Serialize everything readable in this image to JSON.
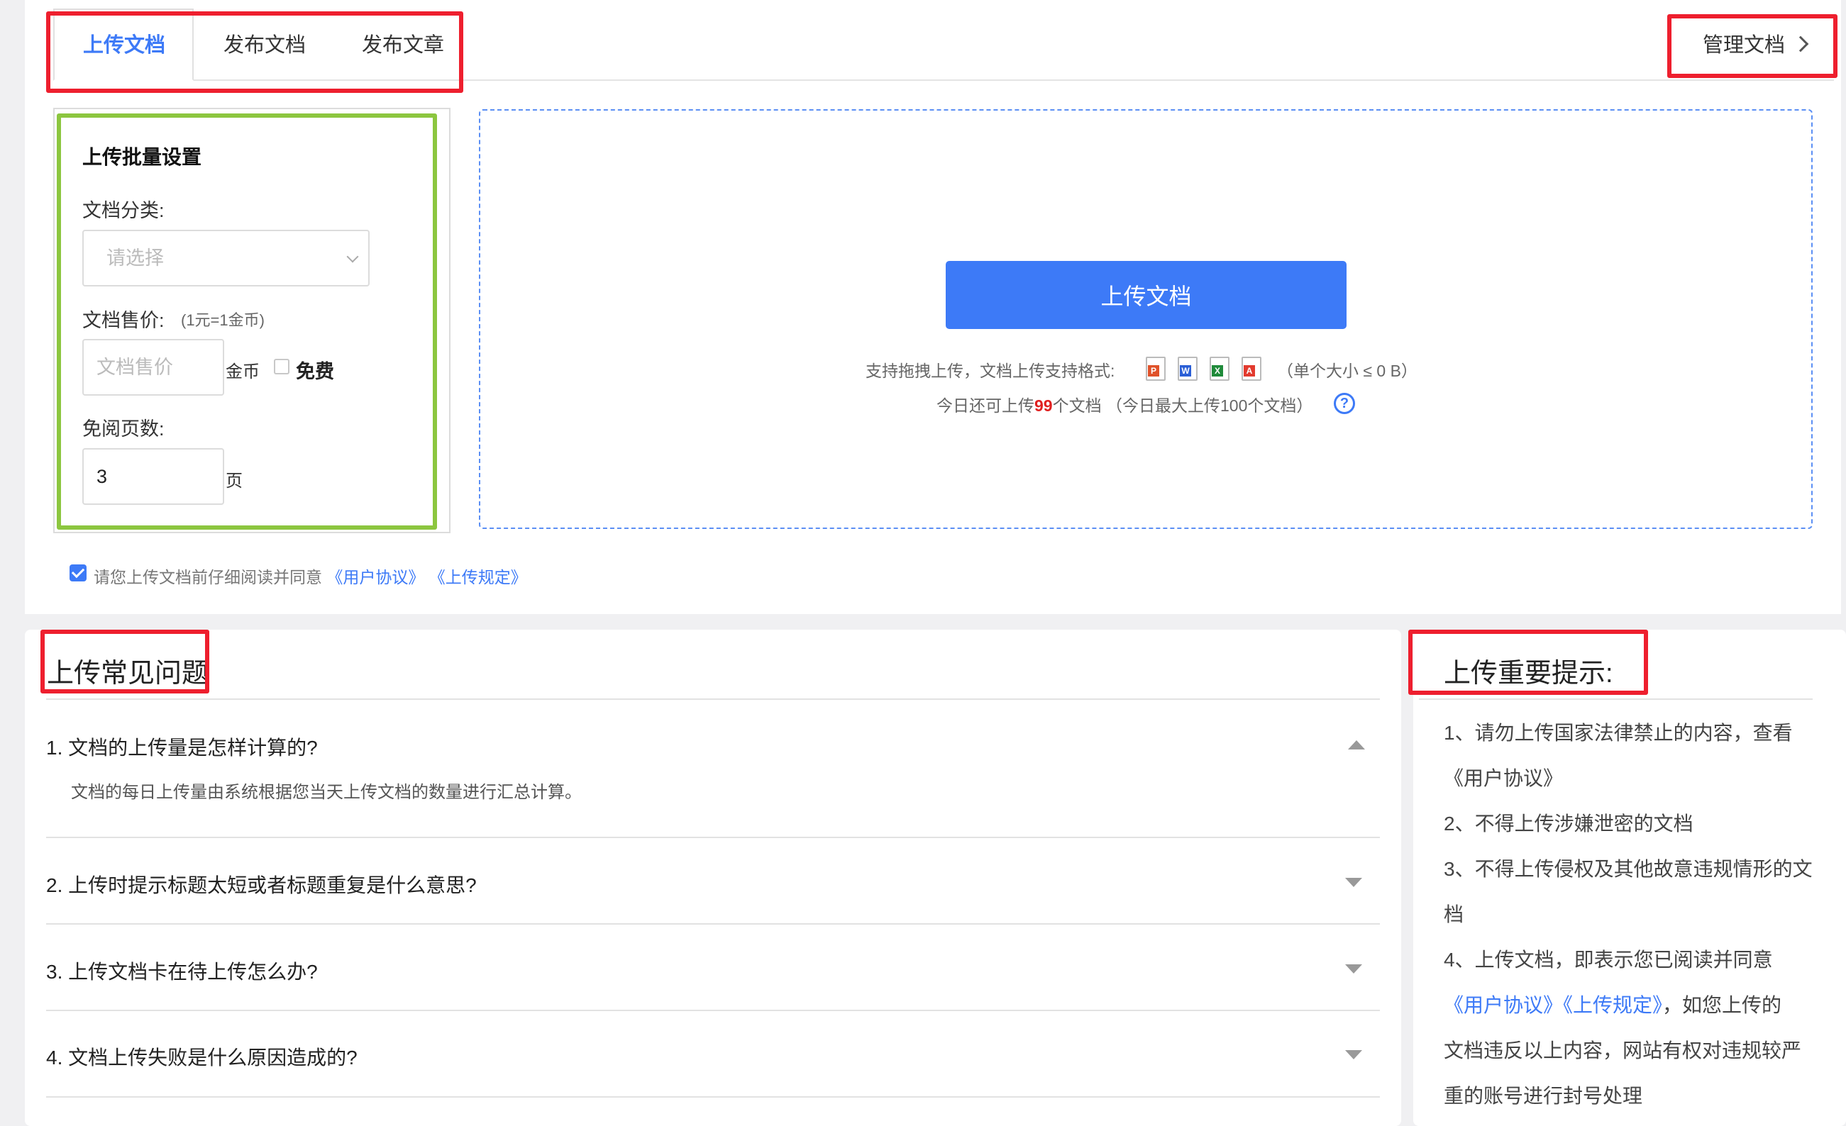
{
  "tabs": [
    {
      "label": "上传文档",
      "active": true
    },
    {
      "label": "发布文档",
      "active": false
    },
    {
      "label": "发布文章",
      "active": false
    }
  ],
  "manage_link": "管理文档",
  "settings": {
    "title": "上传批量设置",
    "category_label": "文档分类:",
    "category_placeholder": "请选择",
    "price_label": "文档售价:",
    "price_hint": "(1元=1金币)",
    "price_placeholder": "文档售价",
    "price_unit": "金币",
    "free_label": "免费",
    "free_pages_label": "免阅页数:",
    "free_pages_value": "3",
    "free_pages_unit": "页"
  },
  "upload": {
    "button": "上传文档",
    "support_text": "支持拖拽上传，文档上传支持格式:",
    "size_text": "（单个大小 ≤ 0 B）",
    "today_prefix": "今日还可上传",
    "today_count": "99",
    "today_suffix": "个文档 （今日最大上传100个文档）",
    "help_icon": "question-circle-icon",
    "file_types": [
      {
        "icon": "ppt-file-icon",
        "letter": "P",
        "color": "#e0522a"
      },
      {
        "icon": "word-file-icon",
        "letter": "W",
        "color": "#2b5fd6"
      },
      {
        "icon": "excel-file-icon",
        "letter": "X",
        "color": "#1f8a3a"
      },
      {
        "icon": "pdf-file-icon",
        "letter": "A",
        "color": "#e23a2e"
      }
    ]
  },
  "agreement": {
    "checked": true,
    "text": "请您上传文档前仔细阅读并同意",
    "link1": "《用户协议》",
    "link2": "《上传规定》"
  },
  "faq": {
    "title": "上传常见问题",
    "items": [
      {
        "q": "1. 文档的上传量是怎样计算的?",
        "a": "文档的每日上传量由系统根据您当天上传文档的数量进行汇总计算。",
        "expanded": true
      },
      {
        "q": "2. 上传时提示标题太短或者标题重复是什么意思?",
        "expanded": false
      },
      {
        "q": "3. 上传文档卡在待上传怎么办?",
        "expanded": false
      },
      {
        "q": "4. 文档上传失败是什么原因造成的?",
        "expanded": false
      }
    ]
  },
  "tips": {
    "title": "上传重要提示:",
    "lines": {
      "l1": "1、请勿上传国家法律禁止的内容，查看",
      "l1_link": "《用户协议》",
      "l2": "2、不得上传涉嫌泄密的文档",
      "l3a": "3、不得上传侵权及其他故意违规情形的文",
      "l3b": "档",
      "l4": "4、上传文档，即表示您已阅读并同意",
      "l4_link1": "《用户协议》",
      "l4_link2": "《上传规定》",
      "l4_rest": "，如您上传的",
      "l5": "文档违反以上内容，网站有权对违规较严",
      "l6": "重的账号进行封号处理"
    }
  }
}
